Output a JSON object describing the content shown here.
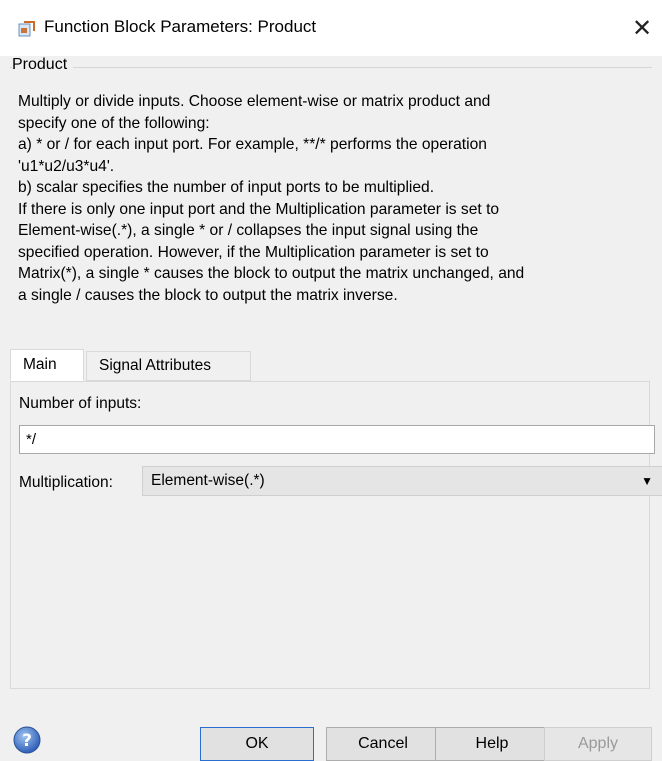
{
  "window": {
    "title": "Function Block Parameters: Product",
    "close_glyph": "✕"
  },
  "group": {
    "label": "Product",
    "description": "Multiply or divide inputs.  Choose element-wise or matrix product and\nspecify one of the following:\n a) * or / for each input port. For example, **/* performs the operation\n'u1*u2/u3*u4'.\n b) scalar specifies the number of input ports to be multiplied.\nIf there is only one input port and the Multiplication parameter is set to\nElement-wise(.*), a single * or / collapses the input signal using the\nspecified operation. However, if the Multiplication parameter is set to\nMatrix(*), a single * causes the block to output the matrix unchanged, and\na single / causes the block to output the matrix inverse."
  },
  "tabs": [
    {
      "label": "Main",
      "active": true
    },
    {
      "label": "Signal Attributes",
      "active": false
    }
  ],
  "main": {
    "number_of_inputs_label": "Number of inputs:",
    "number_of_inputs_value": "*/",
    "multiplication_label": "Multiplication:",
    "multiplication_value": "Element-wise(.*)"
  },
  "buttons": {
    "ok": "OK",
    "cancel": "Cancel",
    "help": "Help",
    "apply": "Apply"
  },
  "icons": {
    "app": "simulink-block-icon",
    "help": "help-question-icon",
    "dropdown": "dropdown-arrow-icon"
  },
  "colors": {
    "accent": "#2a6fd0",
    "help_icon": "#3a6fc9"
  }
}
